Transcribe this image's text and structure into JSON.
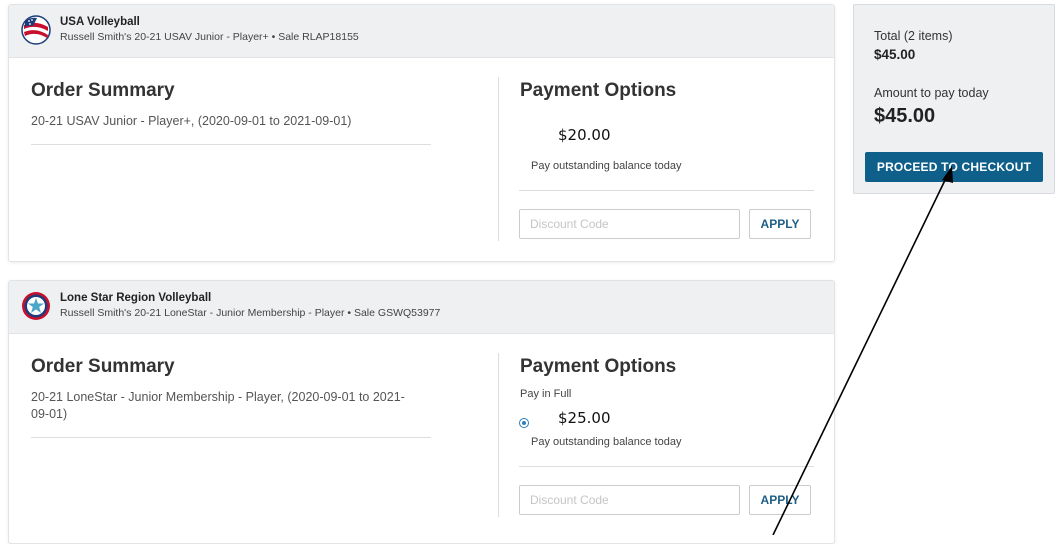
{
  "orders": [
    {
      "org_name": "USA Volleyball",
      "sale_line": "Russell Smith's 20-21 USAV Junior - Player+ • Sale RLAP18155",
      "order_summary_title": "Order Summary",
      "item_description": "20-21 USAV Junior - Player+, (2020-09-01 to 2021-09-01)",
      "payment_options_title": "Payment Options",
      "amount": "$20.00",
      "balance_note": "Pay outstanding balance today",
      "discount_placeholder": "Discount Code",
      "apply_label": "APPLY"
    },
    {
      "org_name": "Lone Star Region Volleyball",
      "sale_line": "Russell Smith's 20-21 LoneStar - Junior Membership - Player • Sale GSWQ53977",
      "order_summary_title": "Order Summary",
      "item_description": "20-21 LoneStar - Junior Membership - Player, (2020-09-01 to 2021-09-01)",
      "payment_options_title": "Payment Options",
      "pay_in_full_label": "Pay in Full",
      "amount": "$25.00",
      "balance_note": "Pay outstanding balance today",
      "discount_placeholder": "Discount Code",
      "apply_label": "APPLY"
    }
  ],
  "summary": {
    "total_label": "Total (2 items)",
    "total_value": "$45.00",
    "today_label": "Amount to pay today",
    "today_value": "$45.00",
    "checkout_label": "PROCEED TO CHECKOUT"
  },
  "colors": {
    "accent": "#0e5f8a",
    "panel_bg": "#eef0f2",
    "radio": "#2c7fb8"
  },
  "icons": [
    "usa-volleyball-logo",
    "lone-star-region-logo",
    "radio-selected-icon",
    "annotation-arrow"
  ]
}
